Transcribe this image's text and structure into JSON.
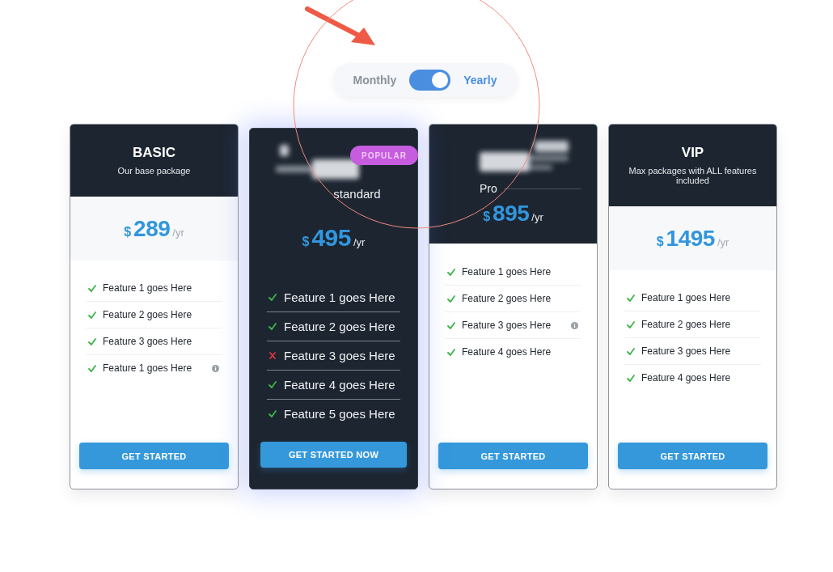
{
  "billing_toggle": {
    "options": [
      {
        "label": "Monthly",
        "selected": false
      },
      {
        "label": "Yearly",
        "selected": true
      }
    ],
    "on": true
  },
  "plans": [
    {
      "kind": "banded",
      "title": "BASIC",
      "subtitle": "Our base package",
      "currency": "$",
      "price": "289",
      "period": "/yr",
      "features": [
        {
          "label": "Feature 1 goes Here",
          "included": true,
          "info": false
        },
        {
          "label": "Feature 2 goes Here",
          "included": true,
          "info": false
        },
        {
          "label": "Feature 3 goes Here",
          "included": true,
          "info": false
        },
        {
          "label": "Feature 1 goes Here",
          "included": true,
          "info": true
        }
      ],
      "button": "GET STARTED"
    },
    {
      "kind": "featured",
      "badge": "POPULAR",
      "subtitle": "standard",
      "currency": "$",
      "price": "495",
      "period": "/yr",
      "features": [
        {
          "label": "Feature 1 goes Here",
          "included": true,
          "info": false
        },
        {
          "label": "Feature 2 goes Here",
          "included": true,
          "info": false
        },
        {
          "label": "Feature 3 goes Here",
          "included": false,
          "info": false
        },
        {
          "label": "Feature 4 goes Here",
          "included": true,
          "info": false
        },
        {
          "label": "Feature 5 goes Here",
          "included": true,
          "info": false
        }
      ],
      "button": "GET STARTED NOW"
    },
    {
      "kind": "headed",
      "subtitle": "Pro",
      "currency": "$",
      "price": "895",
      "period": "/yr",
      "features": [
        {
          "label": "Feature 1 goes Here",
          "included": true,
          "info": false
        },
        {
          "label": "Feature 2 goes Here",
          "included": true,
          "info": false
        },
        {
          "label": "Feature 3 goes Here",
          "included": true,
          "info": true
        },
        {
          "label": "Feature 4 goes Here",
          "included": true,
          "info": false
        }
      ],
      "button": "GET STARTED"
    },
    {
      "kind": "banded",
      "title": "VIP",
      "subtitle": "Max packages with ALL features included",
      "currency": "$",
      "price": "1495",
      "period": "/yr",
      "features": [
        {
          "label": "Feature 1 goes Here",
          "included": true,
          "info": false
        },
        {
          "label": "Feature 2 goes Here",
          "included": true,
          "info": false
        },
        {
          "label": "Feature 3 goes Here",
          "included": true,
          "info": false
        },
        {
          "label": "Feature 4 goes Here",
          "included": true,
          "info": false
        }
      ],
      "button": "GET STARTED"
    }
  ]
}
